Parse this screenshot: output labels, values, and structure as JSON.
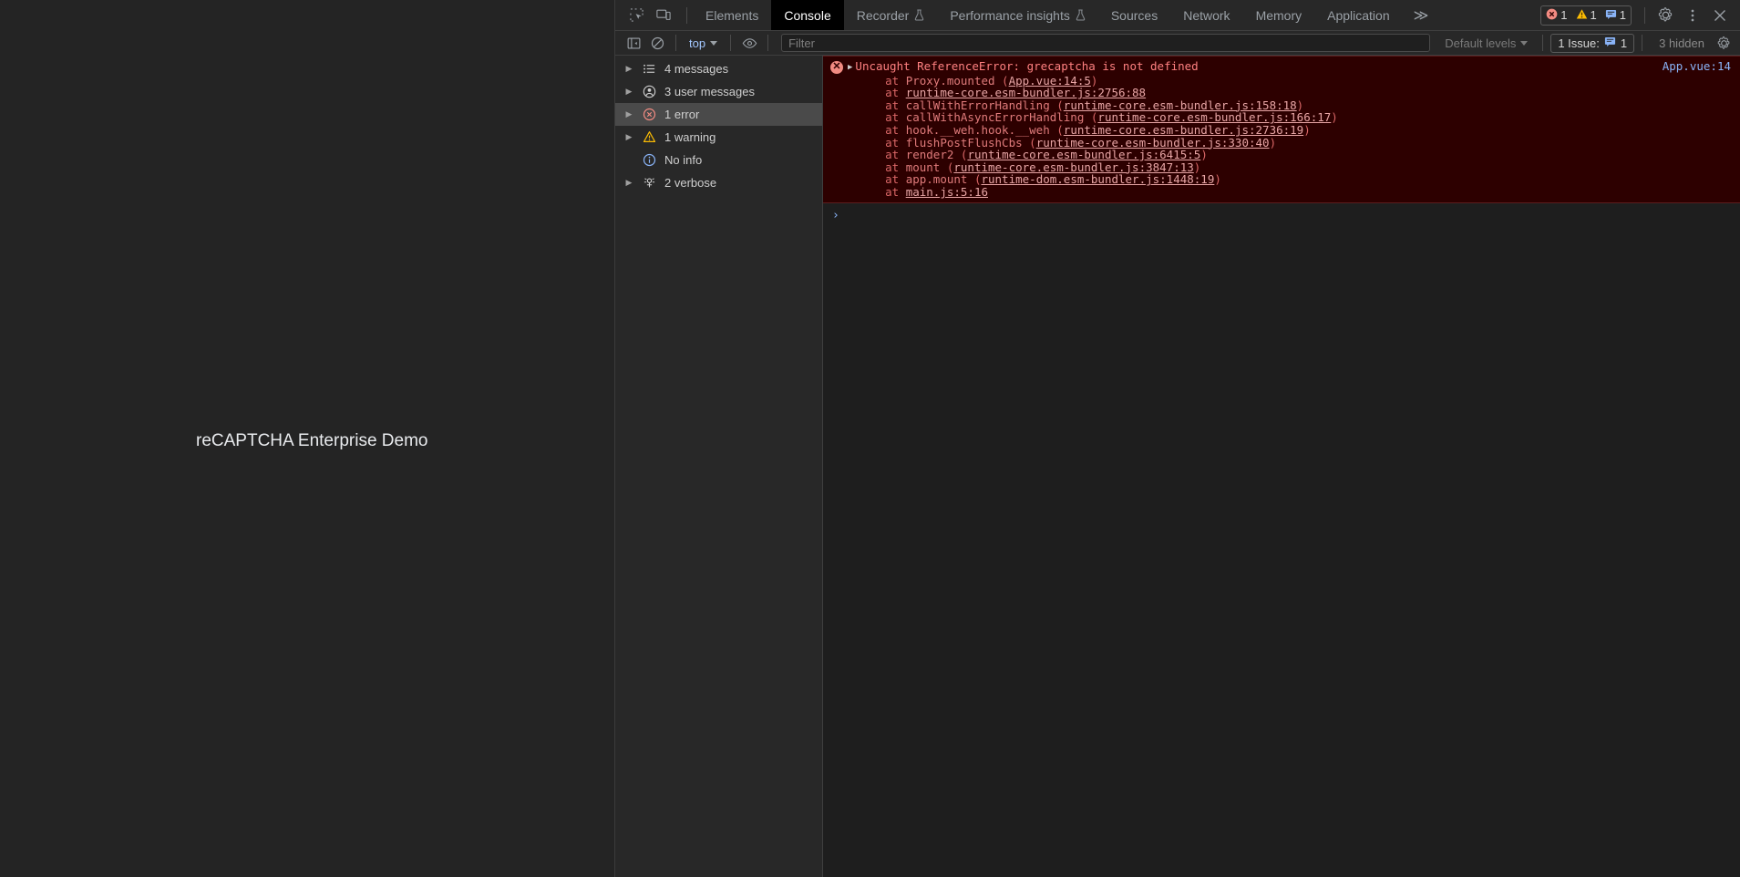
{
  "page": {
    "heading": "reCAPTCHA Enterprise Demo",
    "background": "#242424"
  },
  "devtools": {
    "tabstrip": {
      "inspect_icon": "inspect-element-icon",
      "device_icon": "device-toolbar-icon",
      "tabs": [
        {
          "label": "Elements",
          "active": false,
          "flask": false
        },
        {
          "label": "Console",
          "active": true,
          "flask": false
        },
        {
          "label": "Recorder",
          "active": false,
          "flask": true
        },
        {
          "label": "Performance insights",
          "active": false,
          "flask": true
        },
        {
          "label": "Sources",
          "active": false,
          "flask": false
        },
        {
          "label": "Network",
          "active": false,
          "flask": false
        },
        {
          "label": "Memory",
          "active": false,
          "flask": false
        },
        {
          "label": "Application",
          "active": false,
          "flask": false
        }
      ],
      "more_tabs": "≫",
      "counters": {
        "errors": "1",
        "warnings": "1",
        "messages": "1"
      },
      "settings_label": "gear-icon",
      "kebab_label": "more-options-icon",
      "close_label": "close-icon"
    },
    "console_toolbar": {
      "sidebar_toggle": "console-sidebar-toggle",
      "clear_console": "clear-console-icon",
      "context": "top",
      "eye_icon": "live-expression-icon",
      "filter_placeholder": "Filter",
      "filter_value": "",
      "levels": "Default levels",
      "issues_label": "1 Issue:",
      "issues_count": "1",
      "hidden_label": "3 hidden",
      "settings_icon": "console-settings-icon"
    },
    "sidebar": {
      "items": [
        {
          "label": "4 messages",
          "icon": "list-icon",
          "arrow": true,
          "selected": false
        },
        {
          "label": "3 user messages",
          "icon": "user-icon",
          "arrow": true,
          "selected": false
        },
        {
          "label": "1 error",
          "icon": "error-icon",
          "arrow": true,
          "selected": true
        },
        {
          "label": "1 warning",
          "icon": "warning-icon",
          "arrow": true,
          "selected": false
        },
        {
          "label": "No info",
          "icon": "info-icon",
          "arrow": false,
          "selected": false
        },
        {
          "label": "2 verbose",
          "icon": "verbose-icon",
          "arrow": true,
          "selected": false
        }
      ]
    },
    "console": {
      "error": {
        "title": "Uncaught ReferenceError: grecaptcha is not defined",
        "source_link": "App.vue:14",
        "stack": [
          {
            "prefix": "    at ",
            "fn": "Proxy.mounted ",
            "open": "(",
            "link": "App.vue:14:5",
            "close": ")"
          },
          {
            "prefix": "    at ",
            "fn": "",
            "open": "",
            "link": "runtime-core.esm-bundler.js:2756:88",
            "close": ""
          },
          {
            "prefix": "    at ",
            "fn": "callWithErrorHandling ",
            "open": "(",
            "link": "runtime-core.esm-bundler.js:158:18",
            "close": ")"
          },
          {
            "prefix": "    at ",
            "fn": "callWithAsyncErrorHandling ",
            "open": "(",
            "link": "runtime-core.esm-bundler.js:166:17",
            "close": ")"
          },
          {
            "prefix": "    at ",
            "fn": "hook.__weh.hook.__weh ",
            "open": "(",
            "link": "runtime-core.esm-bundler.js:2736:19",
            "close": ")"
          },
          {
            "prefix": "    at ",
            "fn": "flushPostFlushCbs ",
            "open": "(",
            "link": "runtime-core.esm-bundler.js:330:40",
            "close": ")"
          },
          {
            "prefix": "    at ",
            "fn": "render2 ",
            "open": "(",
            "link": "runtime-core.esm-bundler.js:6415:5",
            "close": ")"
          },
          {
            "prefix": "    at ",
            "fn": "mount ",
            "open": "(",
            "link": "runtime-core.esm-bundler.js:3847:13",
            "close": ")"
          },
          {
            "prefix": "    at ",
            "fn": "app.mount ",
            "open": "(",
            "link": "runtime-dom.esm-bundler.js:1448:19",
            "close": ")"
          },
          {
            "prefix": "    at ",
            "fn": "",
            "open": "",
            "link": "main.js:5:16",
            "close": ""
          }
        ]
      },
      "prompt_caret": "›",
      "prompt_value": ""
    }
  },
  "colors": {
    "error_red": "#f28b82",
    "warning_orange": "#fbbc04",
    "link_blue": "#8ab4f8",
    "error_bg": "#2d0000"
  }
}
